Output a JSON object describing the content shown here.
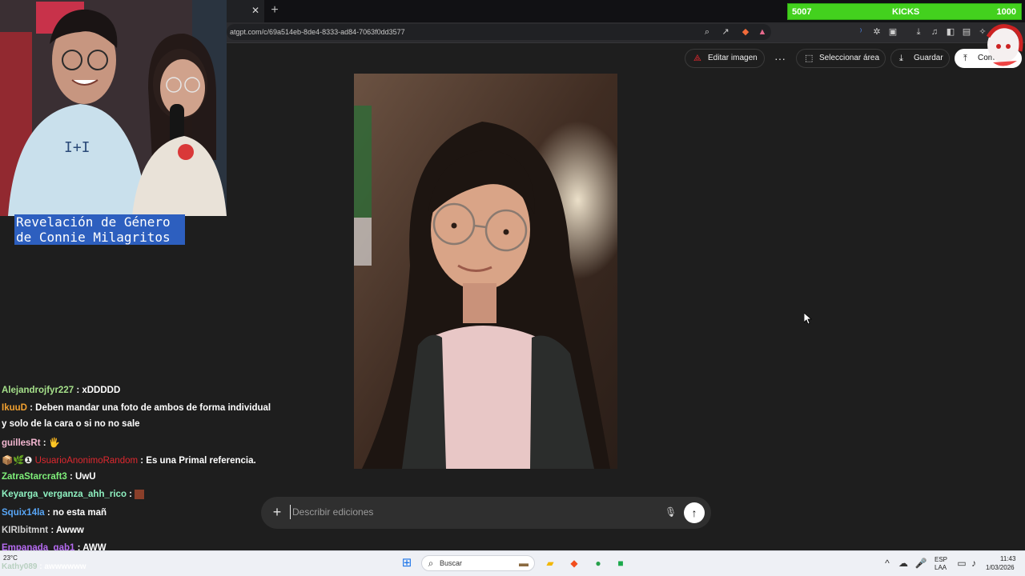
{
  "browser": {
    "tab_close_glyph": "✕",
    "new_tab_glyph": "+",
    "url": "atgpt.com/c/69a514eb-8de4-8333-ad84-7063f0dd3577"
  },
  "kicks_widget": {
    "left_value": "5007",
    "label": "KICKS",
    "right_value": "1000",
    "fill_fraction": 1.0,
    "color": "#43d11e"
  },
  "page_actions": {
    "edit_image": "Editar imagen",
    "select_area": "Seleccionar área",
    "save": "Guardar",
    "share": "Com"
  },
  "composer": {
    "placeholder": "Describir ediciones"
  },
  "overlay": {
    "caption_line1": "Revelación de Género",
    "caption_line2": "de Connie Milagritos"
  },
  "chat": [
    {
      "user": "Alejandrojfyr227",
      "user_color": "#a5e08a",
      "message": ": xDDDDD"
    },
    {
      "user": "IkuuD",
      "user_color": "#f0a030",
      "message": ": Deben mandar una foto de ambos de forma individual"
    },
    {
      "user": "",
      "user_color": "#ffffff",
      "message": "y solo de la cara o si no no sale"
    },
    {
      "user": "guillesRt",
      "user_color": "#f3b7d1",
      "message": ": 🖐"
    },
    {
      "user": "UsuarioAnonimoRandom",
      "user_color": "#e0282f",
      "message": ": Es una Primal referencia.",
      "badges": "📦🌿❶"
    },
    {
      "user": "ZatraStarcraft3",
      "user_color": "#7ff07a",
      "message": ": UwU"
    },
    {
      "user": "Keyarga_verganza_ahh_rico",
      "user_color": "#8ef0c0",
      "message": ":"
    },
    {
      "user": "Squix14la",
      "user_color": "#58a6f6",
      "message": ": no esta mañ"
    },
    {
      "user": "KIRIbitmnt",
      "user_color": "#d0d0d0",
      "message": ": Awww"
    },
    {
      "user": "Empanada_gab1",
      "user_color": "#b56bf0",
      "message": ": AWW"
    },
    {
      "user": "Kathy089",
      "user_color": "#b8d0c0",
      "message": ": awwwwww"
    }
  ],
  "taskbar": {
    "search_label": "Buscar",
    "weather_temp": "23°C",
    "lang_line1": "ESP",
    "lang_line2": "LAA",
    "time": "11:43",
    "date": "1/03/2026"
  }
}
